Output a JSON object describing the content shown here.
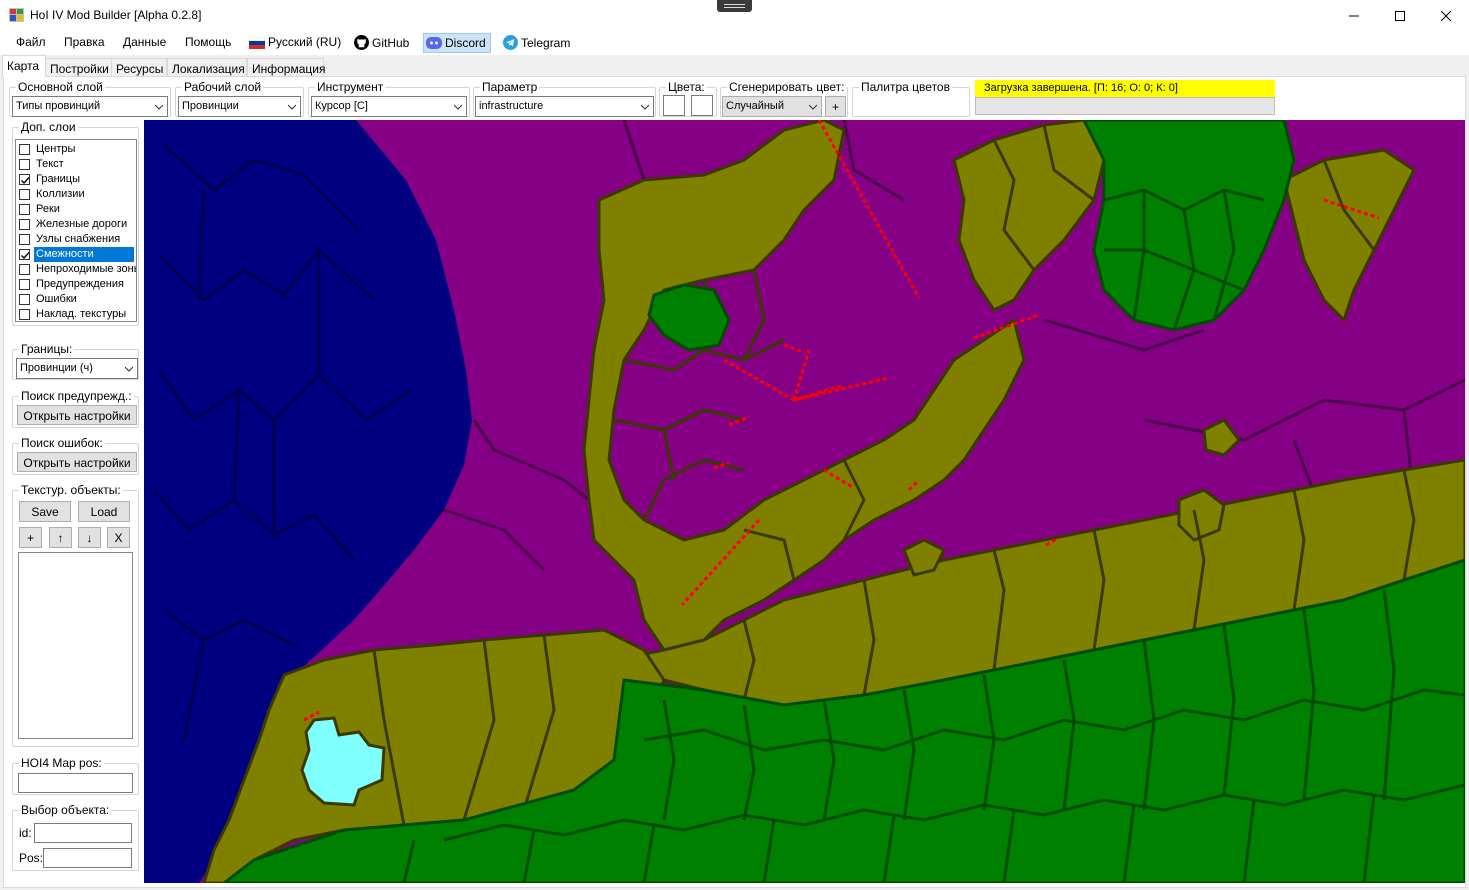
{
  "window": {
    "title": "HoI IV Mod Builder [Alpha 0.2.8]",
    "minimize": "—",
    "maximize": "☐",
    "close": "✕"
  },
  "menu": {
    "file": "Файл",
    "edit": "Правка",
    "data": "Данные",
    "help": "Помощь",
    "language": "Русский (RU)",
    "github": "GitHub",
    "discord": "Discord",
    "telegram": "Telegram"
  },
  "tabs": [
    "Карта",
    "Постройки",
    "Ресурсы",
    "Локализация",
    "Информация"
  ],
  "toolbar": {
    "main_layer": {
      "title": "Основной слой",
      "value": "Типы провинций"
    },
    "work_layer": {
      "title": "Рабочий слой",
      "value": "Провинции"
    },
    "tool": {
      "title": "Инструмент",
      "value": "Курсор [C]"
    },
    "parameter": {
      "title": "Параметр",
      "value": "infrastructure"
    },
    "colors": {
      "title": "Цвета:"
    },
    "generate_color": {
      "title": "Сгенерировать цвет:",
      "value": "Случайный",
      "add": "+"
    },
    "palette": {
      "title": "Палитра цветов"
    },
    "status": "Загрузка завершена. [П: 16; О: 0; К: 0]"
  },
  "sidebar": {
    "layers": {
      "title": "Доп. слои",
      "items": [
        {
          "label": "Центры",
          "checked": false
        },
        {
          "label": "Текст",
          "checked": false
        },
        {
          "label": "Границы",
          "checked": true
        },
        {
          "label": "Коллизии",
          "checked": false
        },
        {
          "label": "Реки",
          "checked": false
        },
        {
          "label": "Железные дороги",
          "checked": false
        },
        {
          "label": "Узлы снабжения",
          "checked": false
        },
        {
          "label": "Смежности",
          "checked": true,
          "selected": true
        },
        {
          "label": "Непроходимые зоны",
          "checked": false
        },
        {
          "label": "Предупреждения",
          "checked": false
        },
        {
          "label": "Ошибки",
          "checked": false
        },
        {
          "label": "Наклад. текстуры",
          "checked": false
        }
      ]
    },
    "borders": {
      "title": "Границы:",
      "value": "Провинции (ч)"
    },
    "warnings": {
      "title": "Поиск предупрежд.:",
      "button": "Открыть настройки"
    },
    "errors": {
      "title": "Поиск ошибок:",
      "button": "Открыть настройки"
    },
    "texture_objects": {
      "title": "Текстур. объекты:",
      "save": "Save",
      "load": "Load",
      "add": "+",
      "up": "↑",
      "down": "↓",
      "remove": "X"
    },
    "map_pos": {
      "title": "HOI4 Map pos:",
      "value": ""
    },
    "object_select": {
      "title": "Выбор объекта:",
      "id_label": "id:",
      "pos_label": "Pos:",
      "id_value": "",
      "pos_value": ""
    }
  },
  "colors": {
    "sea": "#000080",
    "sea_border": "#000050",
    "region": "#850085",
    "coastal": "#808000",
    "land": "#008000",
    "selected": "#80ffff",
    "adjacency": "#ff0000",
    "status_bg": "#ffff00",
    "discord_bg": "#cce4f7"
  }
}
